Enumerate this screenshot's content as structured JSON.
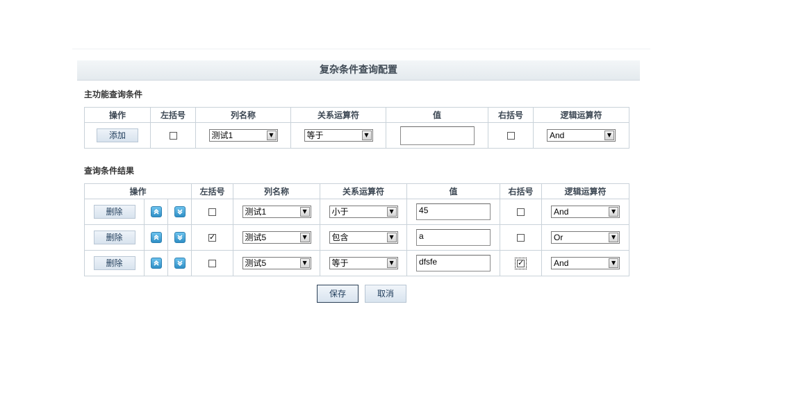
{
  "page_title": "复杂条件查询配置",
  "main_section": {
    "title": "主功能查询条件",
    "headers": [
      "操作",
      "左括号",
      "列名称",
      "关系运算符",
      "值",
      "右括号",
      "逻辑运算符"
    ],
    "add_button": "添加",
    "left_paren_checked": false,
    "column_value": "测试1",
    "operator_value": "等于",
    "value_input": "",
    "right_paren_checked": false,
    "logic_value": "And"
  },
  "result_section": {
    "title": "查询条件结果",
    "headers": [
      "操作",
      "左括号",
      "列名称",
      "关系运算符",
      "值",
      "右括号",
      "逻辑运算符"
    ],
    "delete_label": "删除",
    "rows": [
      {
        "left_paren": false,
        "column": "测试1",
        "operator": "小于",
        "value": "45",
        "right_paren": false,
        "logic": "And"
      },
      {
        "left_paren": true,
        "column": "测试5",
        "operator": "包含",
        "value": "a",
        "right_paren": false,
        "logic": "Or"
      },
      {
        "left_paren": false,
        "column": "测试5",
        "operator": "等于",
        "value": "dfsfe",
        "right_paren": true,
        "logic": "And"
      }
    ]
  },
  "footer": {
    "save_label": "保存",
    "cancel_label": "取消"
  },
  "icons": {
    "move_up": "double-chevron-up-icon",
    "move_down": "double-chevron-down-icon",
    "dropdown": "triangle-down-icon"
  },
  "colors": {
    "icon_blue": "#3a9ad6",
    "header_text": "#3d4854",
    "grid_border": "#c9d2d9"
  }
}
